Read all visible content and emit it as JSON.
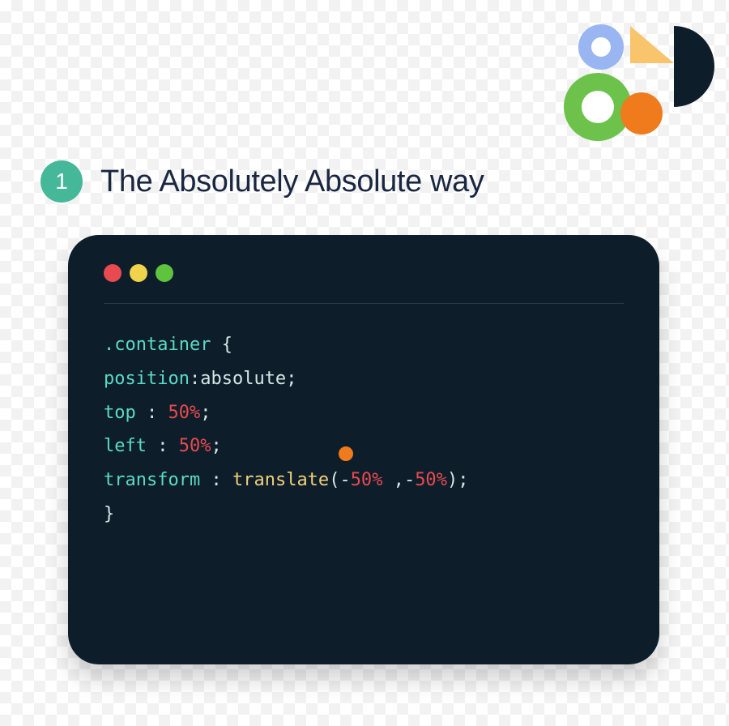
{
  "badge": {
    "number": "1"
  },
  "heading": "The Absolutely Absolute way",
  "code": {
    "selector": ".container",
    "open_brace": "{",
    "close_brace": "}",
    "lines": [
      {
        "prop": "position",
        "colon": ":",
        "value": "absolute",
        "semicolon": ";"
      },
      {
        "prop": "top",
        "colon": " : ",
        "num": "50",
        "pct": "%",
        "semicolon": ";"
      },
      {
        "prop": "left",
        "colon": " : ",
        "num": "50",
        "pct": "%",
        "semicolon": ";"
      },
      {
        "prop": "transform",
        "colon": " : ",
        "func": "translate",
        "open": "(",
        "arg1_minus": "-",
        "arg1_num": "50",
        "arg1_pct": "%",
        "sep": " ,",
        "arg2_minus": "-",
        "arg2_num": "50",
        "arg2_pct": "%",
        "close": ")",
        "semicolon": ";"
      }
    ]
  },
  "colors": {
    "badge_bg": "#46b89a",
    "window_bg": "#0d1e2a",
    "red": "#e84a4f",
    "yellow": "#f0d24c",
    "green": "#5ec43d",
    "teal": "#5bd9c6",
    "orange": "#f07b1c"
  }
}
